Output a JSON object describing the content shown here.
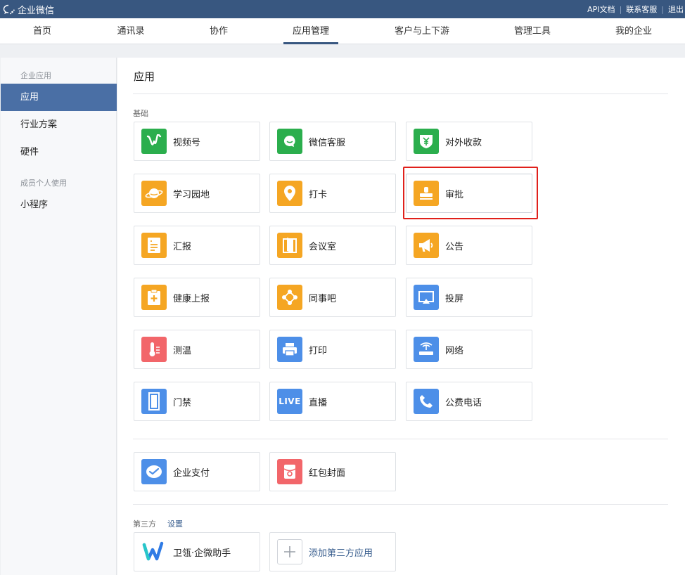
{
  "topbar": {
    "brand": "企业微信",
    "links": [
      "API文档",
      "联系客服",
      "退出"
    ]
  },
  "nav": {
    "items": [
      "首页",
      "通讯录",
      "协作",
      "应用管理",
      "客户与上下游",
      "管理工具",
      "我的企业"
    ],
    "active": "应用管理"
  },
  "sidebar": {
    "section_enterprise": "企业应用",
    "item_apps": "应用",
    "item_industry": "行业方案",
    "item_hardware": "硬件",
    "section_personal": "成员个人使用",
    "item_miniprogram": "小程序"
  },
  "main": {
    "title": "应用",
    "group_basic": "基础",
    "apps": {
      "channels": "视频号",
      "kf": "微信客服",
      "payment": "对外收款",
      "study": "学习园地",
      "checkin": "打卡",
      "approval": "审批",
      "report": "汇报",
      "meeting": "会议室",
      "notice": "公告",
      "health": "健康上报",
      "colleague": "同事吧",
      "cast": "投屏",
      "temp": "测温",
      "print": "打印",
      "network": "网络",
      "door": "门禁",
      "live": "直播",
      "phone": "公费电话",
      "pay": "企业支付",
      "redpacket": "红包封面"
    },
    "live_badge": "LIVE",
    "group_third": "第三方",
    "settings_link": "设置",
    "third_apps": {
      "assistant": "卫瓴·企微助手",
      "add": "添加第三方应用"
    }
  },
  "colors": {
    "topbar": "#385780",
    "accent": "#4a6fa5",
    "green": "#2bae4d",
    "orange": "#f5a623",
    "blue": "#4d8fe8",
    "red_pink": "#f2666a",
    "highlight": "#e0201b"
  },
  "icons": {
    "channels": "channels-icon",
    "kf": "chat-bubble-icon",
    "payment": "yuan-shield-icon",
    "study": "planet-icon",
    "checkin": "location-pin-icon",
    "approval": "stamp-icon",
    "report": "document-list-icon",
    "meeting": "door-icon",
    "notice": "megaphone-icon",
    "health": "clipboard-plus-icon",
    "colleague": "network-nodes-icon",
    "cast": "screen-cast-icon",
    "temp": "thermometer-icon",
    "print": "printer-icon",
    "network": "router-icon",
    "door": "access-door-icon",
    "live": "live-badge-icon",
    "phone": "phone-icon",
    "pay": "pay-check-icon",
    "redpacket": "red-packet-icon",
    "assistant": "w-logo-icon",
    "add": "plus-icon"
  }
}
